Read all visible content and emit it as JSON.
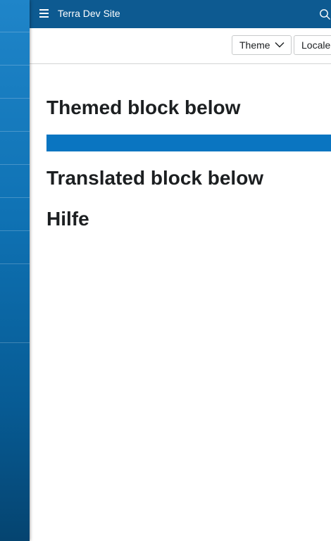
{
  "header": {
    "site_title": "Terra Dev Site",
    "icons": {
      "menu": "hamburger-menu-icon",
      "search": "search-icon"
    }
  },
  "toolbar": {
    "theme_label": "Theme",
    "locale_label": "Locale"
  },
  "content": {
    "themed_heading": "Themed block below",
    "translated_heading": "Translated block below",
    "translated_text": "Hilfe"
  },
  "colors": {
    "header_bg": "#0d5a91",
    "sidebar_top": "#1f85c9",
    "sidebar_bottom": "#054470",
    "themed_block": "#0a75c1",
    "heading_text": "#1c1f21"
  }
}
